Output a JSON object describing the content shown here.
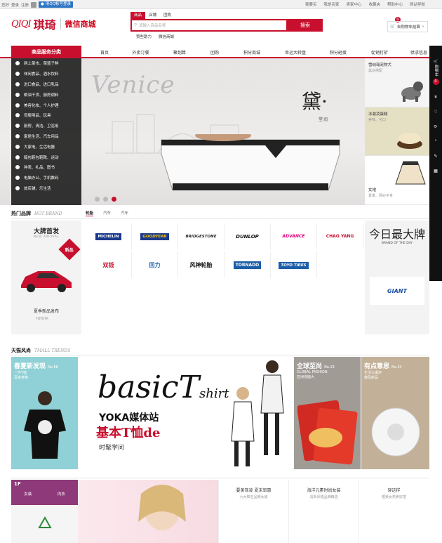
{
  "topbar": {
    "left": [
      "您好",
      "登录",
      "注册"
    ],
    "qq_login": "用QQ帐号登录",
    "right": [
      "我要买",
      "我是买家",
      "卖家中心",
      "收藏夹",
      "帮助中心",
      "网站导航"
    ]
  },
  "header": {
    "logo_en": "QIQI",
    "logo_cn": "琪琦",
    "logo_sub": "微信商城",
    "search_tabs": [
      "商品",
      "店铺",
      "团购"
    ],
    "search_placeholder": "请输入商品名称",
    "search_button": "搜索",
    "hot_words": [
      "赞些助力",
      "微信商城"
    ],
    "cart_label": "去购物车结算",
    "cart_count": "0"
  },
  "nav": {
    "category_title": "商品服务分类",
    "items": [
      "首页",
      "外卖订餐",
      "聚划算",
      "团购",
      "积分商城",
      "幸运大转盘",
      "积分砸蛋",
      "促销打折",
      "供求信息"
    ]
  },
  "categories": [
    "网上菜市、菜篮子鲜",
    "休闲食品、酒水饮料",
    "进口食品、进口乳品",
    "粮油干货、厨房调料",
    "美容化妆、个人护理",
    "母婴用品、玩具",
    "厨房、清洁、卫浴用",
    "家居生活、汽车用品",
    "大家电、生活电器",
    "箱包鞋包鞋靴、运动",
    "钟表、礼品、图书",
    "电脑办公、手机数码",
    "旅店铺、乐生活"
  ],
  "banner": {
    "watermark": "Venice",
    "brand_title": "黛·",
    "brand_sub": "堂润"
  },
  "promos": [
    {
      "title": "雪纳瑞宠物犬",
      "sub": "黑白搭配"
    },
    {
      "title": "冰激凌蛋糕",
      "sub": "美味、可口"
    },
    {
      "title": "女裙",
      "sub": "夏季、网纱半身"
    }
  ],
  "right_toolbar": {
    "cart_text": "购物车",
    "cart_count": "0"
  },
  "hot_brand": {
    "title": "热门品牌",
    "title_en": "HOT BRAND",
    "tabs": [
      "轮胎",
      "汽车",
      "汽车"
    ],
    "new_arrival": {
      "title": "大牌首发",
      "sub": "NEW ARRIVAL",
      "badge": "新品",
      "desc": "夏季新品发布",
      "logo": "TOYOTA"
    },
    "brands": [
      {
        "name": "MICHELIN",
        "color": "#1c3a8b"
      },
      {
        "name": "GOODYEAR",
        "color": "#1c3a8b"
      },
      {
        "name": "BRIDGESTONE",
        "color": "#222222"
      },
      {
        "name": "DUNLOP",
        "color": "#111111"
      },
      {
        "name": "ADVANCE",
        "color": "#e0007a"
      },
      {
        "name": "CHAO YANG",
        "color": "#c8102e"
      },
      {
        "name": "双钱",
        "color": "#c8102e"
      },
      {
        "name": "回力",
        "color": "#1c5fa8"
      },
      {
        "name": "风神轮胎",
        "color": "#111111"
      },
      {
        "name": "TORNADO",
        "color": "#1c5fa8"
      },
      {
        "name": "TOYO TIRES",
        "color": "#1c5fa8"
      }
    ],
    "brand_of_day": {
      "title": "今日最大牌",
      "sub": "BRAND OF THE DAY",
      "logo": "GIANT"
    }
  },
  "tmall": {
    "title": "天猫风尚",
    "title_en": "TMALL TRENDS",
    "left": {
      "title": "春夏新发现",
      "num": "No.68",
      "sub1": "一件T恤",
      "sub2": "百变穿搭"
    },
    "center": {
      "script": "basicT",
      "script2": "shirt",
      "yoka": "YOKA媒体站",
      "tee": "基本T恤de",
      "sub": "时髦学问"
    },
    "card3": {
      "title": "全球至尚",
      "num": "No.33",
      "sub1": "GLOBAL FASHION",
      "sub2": "亚洲泡面大"
    },
    "card4": {
      "title": "有点意思",
      "num": "No.34",
      "sub1": "生活大爆炸",
      "sub2": "数码新品"
    }
  },
  "floor": {
    "label": "1F",
    "tabs": [
      "女装",
      "内衣"
    ],
    "cards": [
      {
        "title": "要美驾凌 夏末钜惠",
        "sub": "六大知名品牌女装"
      },
      {
        "title": "海洋元素时尚女装",
        "sub": "清新风格品牌精选"
      },
      {
        "title": "穿这样",
        "sub": "晒美女热卖好搭"
      }
    ]
  }
}
